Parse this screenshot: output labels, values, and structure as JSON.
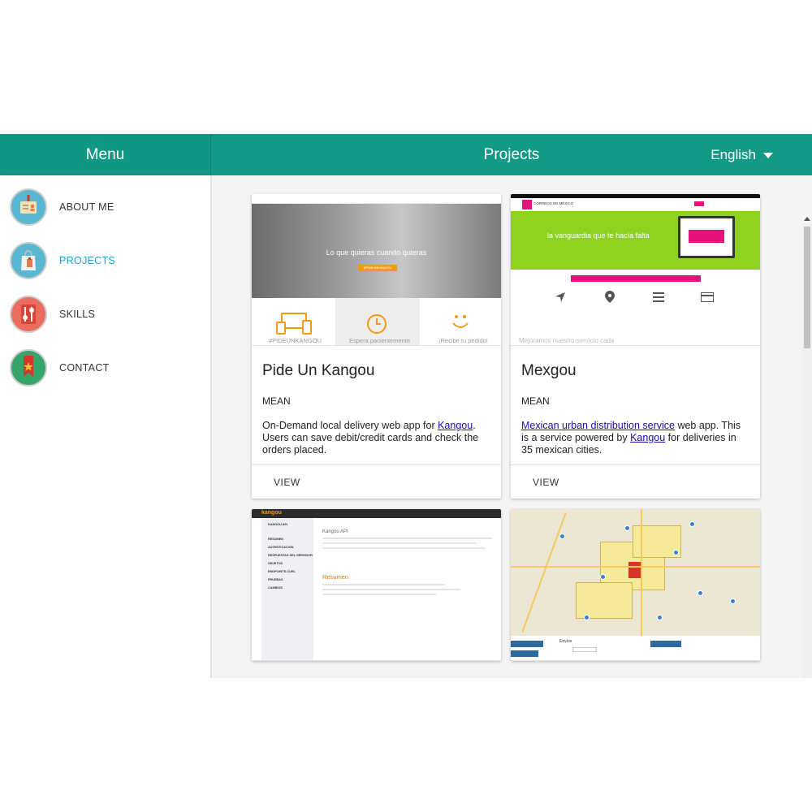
{
  "header": {
    "menu_title": "Menu",
    "page_title": "Projects",
    "language": "English"
  },
  "sidebar": {
    "items": [
      {
        "label": "ABOUT ME",
        "icon": "id-badge-icon",
        "active": false
      },
      {
        "label": "PROJECTS",
        "icon": "shopping-bag-icon",
        "active": true
      },
      {
        "label": "SKILLS",
        "icon": "sliders-icon",
        "active": false
      },
      {
        "label": "CONTACT",
        "icon": "ribbon-star-icon",
        "active": false
      }
    ]
  },
  "projects": [
    {
      "title": "Pide Un Kangou",
      "tag": "MEAN",
      "desc_before": "On-Demand local delivery web app for ",
      "desc_link1": "Kangou",
      "desc_middle": ". Users can save debit/credit cards and check the orders placed.",
      "desc_link2": "",
      "desc_after": "",
      "view_label": "VIEW",
      "thumb": {
        "hero_text": "Lo que quieras cuando quieras",
        "button_text": "#PIDEUNKANGOU",
        "caption_left": "#PIDEUNKANGOU",
        "caption_mid": "Espera pacientemente",
        "caption_right": "¡Recibe tu pedido!"
      }
    },
    {
      "title": "Mexgou",
      "tag": "MEAN",
      "desc_link0": "Mexican urban distribution service",
      "desc_before": " web app. This is a service powered by ",
      "desc_link1": "Kangou",
      "desc_middle": " for deliveries in 35 mexican cities.",
      "view_label": "VIEW",
      "thumb": {
        "hero_text": "la vanguardia que te hacía falta",
        "brand_text": "CORREOS DE MÉXICO",
        "footer_text": "Mejoramos nuestro servicio cada"
      }
    },
    {
      "thumb": {
        "logo": "kangou",
        "heading": "Kangou API",
        "section": "Resumen",
        "side_items": [
          "KANGOU API",
          "RESUMEN",
          "AUTENTICACIÓN",
          "RESPUESTAS DEL SERVIDOR",
          "OBJETOS",
          "ENDPOINTS-CURL",
          "PRUEBAS",
          "CAMBIOS"
        ]
      }
    },
    {
      "thumb": {
        "panel_title": "Envíos"
      }
    }
  ],
  "colors": {
    "header_bg": "#139a86",
    "active_link": "#1aa3d8",
    "link": "#1a0dab"
  }
}
